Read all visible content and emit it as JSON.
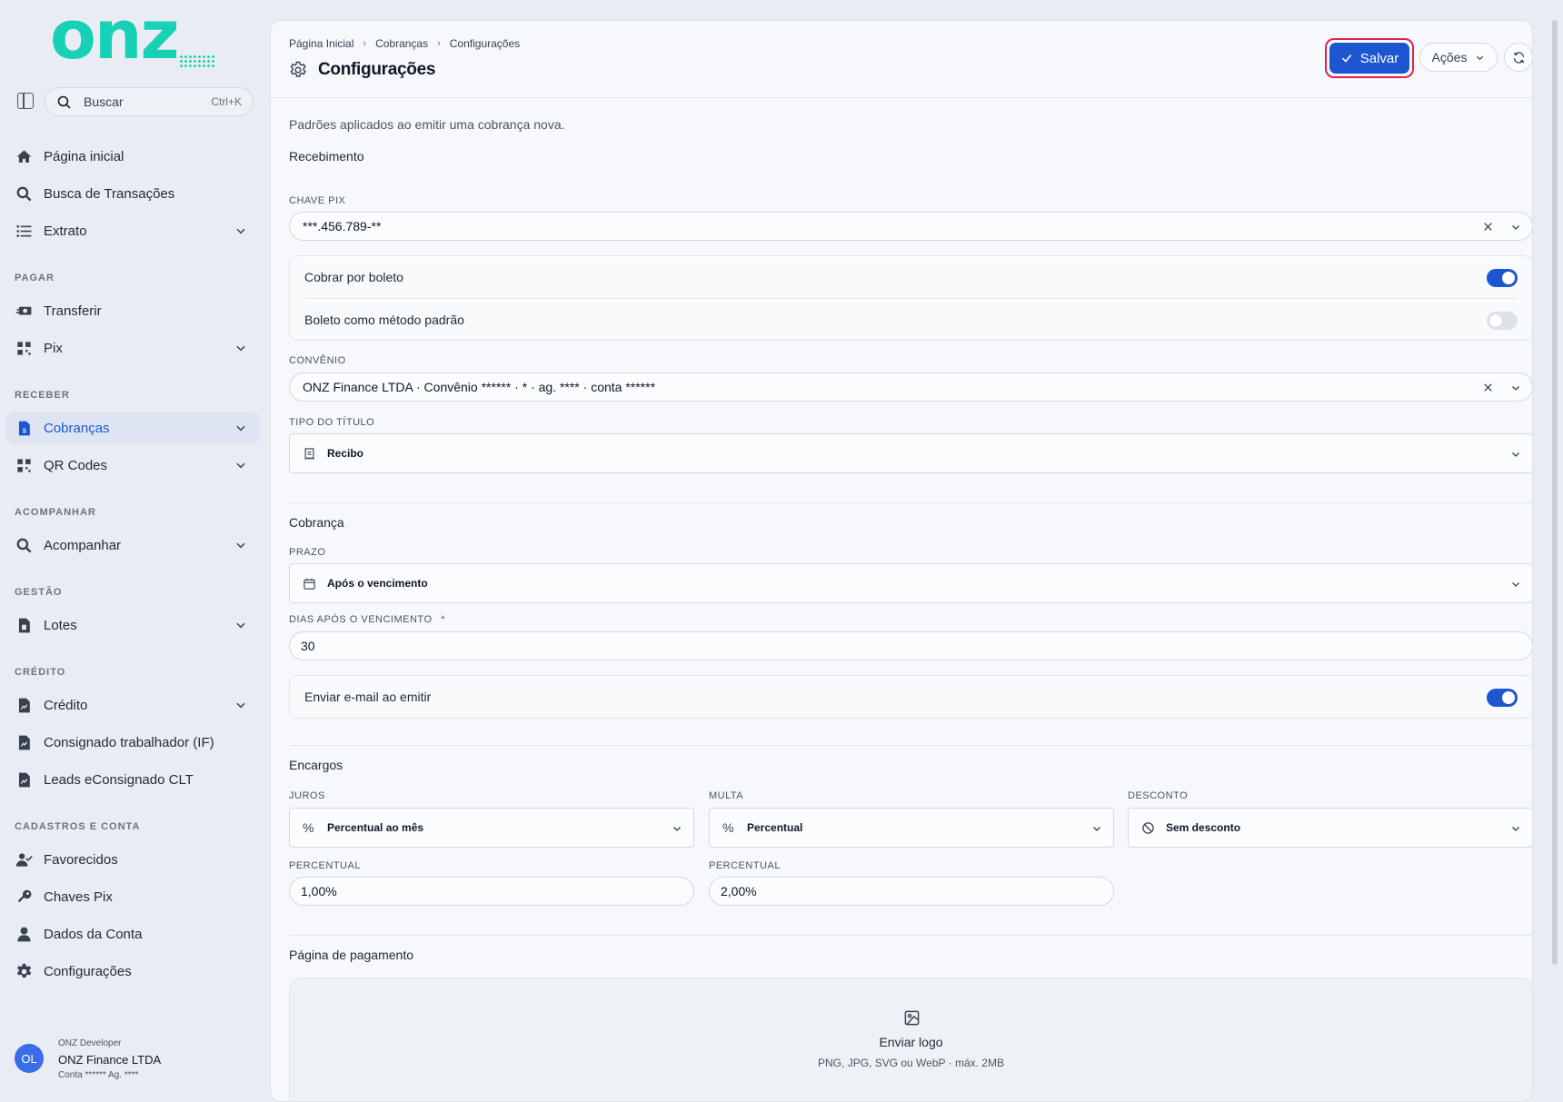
{
  "brand": {
    "logo_text": "onz",
    "accent_color": "#16d1b6",
    "primary_color": "#1e56d1",
    "highlight_color": "#e0234c"
  },
  "sidebar": {
    "search": {
      "label": "Buscar",
      "shortcut": "Ctrl+K"
    },
    "top_items": [
      {
        "label": "Página inicial",
        "icon": "home-icon"
      },
      {
        "label": "Busca de Transações",
        "icon": "search-icon"
      },
      {
        "label": "Extrato",
        "icon": "list-icon",
        "expandable": true
      }
    ],
    "sections": [
      {
        "title": "PAGAR",
        "items": [
          {
            "label": "Transferir",
            "icon": "money-transfer-icon"
          },
          {
            "label": "Pix",
            "icon": "grid-icon",
            "expandable": true
          }
        ]
      },
      {
        "title": "RECEBER",
        "items": [
          {
            "label": "Cobranças",
            "icon": "invoice-icon",
            "expandable": true,
            "active": true
          },
          {
            "label": "QR Codes",
            "icon": "qrcode-icon",
            "expandable": true
          }
        ]
      },
      {
        "title": "ACOMPANHAR",
        "items": [
          {
            "label": "Acompanhar",
            "icon": "search-icon",
            "expandable": true
          }
        ]
      },
      {
        "title": "GESTÃO",
        "items": [
          {
            "label": "Lotes",
            "icon": "file-icon",
            "expandable": true
          }
        ]
      },
      {
        "title": "CRÉDITO",
        "items": [
          {
            "label": "Crédito",
            "icon": "file-chart-icon",
            "expandable": true
          },
          {
            "label": "Consignado trabalhador (IF)",
            "icon": "file-chart-icon"
          },
          {
            "label": "Leads eConsignado CLT",
            "icon": "file-chart-icon"
          }
        ]
      },
      {
        "title": "CADASTROS E CONTA",
        "items": [
          {
            "label": "Favorecidos",
            "icon": "user-check-icon"
          },
          {
            "label": "Chaves Pix",
            "icon": "key-icon"
          },
          {
            "label": "Dados da Conta",
            "icon": "user-icon"
          },
          {
            "label": "Configurações",
            "icon": "gear-icon"
          }
        ]
      }
    ],
    "user": {
      "initials": "OL",
      "role": "ONZ Developer",
      "company": "ONZ Finance LTDA",
      "account": "Conta ****** Ag. ****"
    }
  },
  "header": {
    "breadcrumbs": [
      "Página Inicial",
      "Cobranças",
      "Configurações"
    ],
    "title": "Configurações",
    "save_label": "Salvar",
    "actions_label": "Ações"
  },
  "content": {
    "description": "Padrões aplicados ao emitir uma cobrança nova.",
    "recebimento": {
      "title": "Recebimento",
      "pix_label": "CHAVE PIX",
      "pix_value": "***.456.789-**",
      "toggle_boleto": {
        "label": "Cobrar por boleto",
        "on": true
      },
      "toggle_default": {
        "label": "Boleto como método padrão",
        "on": false
      },
      "convenio_label": "CONVÊNIO",
      "convenio_value": "ONZ Finance LTDA · Convênio ****** · * · ag. **** · conta ******",
      "tipo_label": "TIPO DO TÍTULO",
      "tipo_value": "Recibo"
    },
    "cobranca": {
      "title": "Cobrança",
      "prazo_label": "PRAZO",
      "prazo_value": "Após o vencimento",
      "dias_label": "DIAS APÓS O VENCIMENTO",
      "required_mark": "*",
      "dias_value": "30",
      "toggle_email": {
        "label": "Enviar e-mail ao emitir",
        "on": true
      }
    },
    "encargos": {
      "title": "Encargos",
      "juros_label": "JUROS",
      "juros_value": "Percentual ao mês",
      "multa_label": "MULTA",
      "multa_value": "Percentual",
      "desconto_label": "DESCONTO",
      "desconto_value": "Sem desconto",
      "percentual_label": "PERCENTUAL",
      "juros_percent": "1,00%",
      "multa_percent": "2,00%"
    },
    "pagina": {
      "title": "Página de pagamento",
      "upload_title": "Enviar logo",
      "upload_hint": "PNG, JPG, SVG ou WebP · máx. 2MB"
    }
  }
}
